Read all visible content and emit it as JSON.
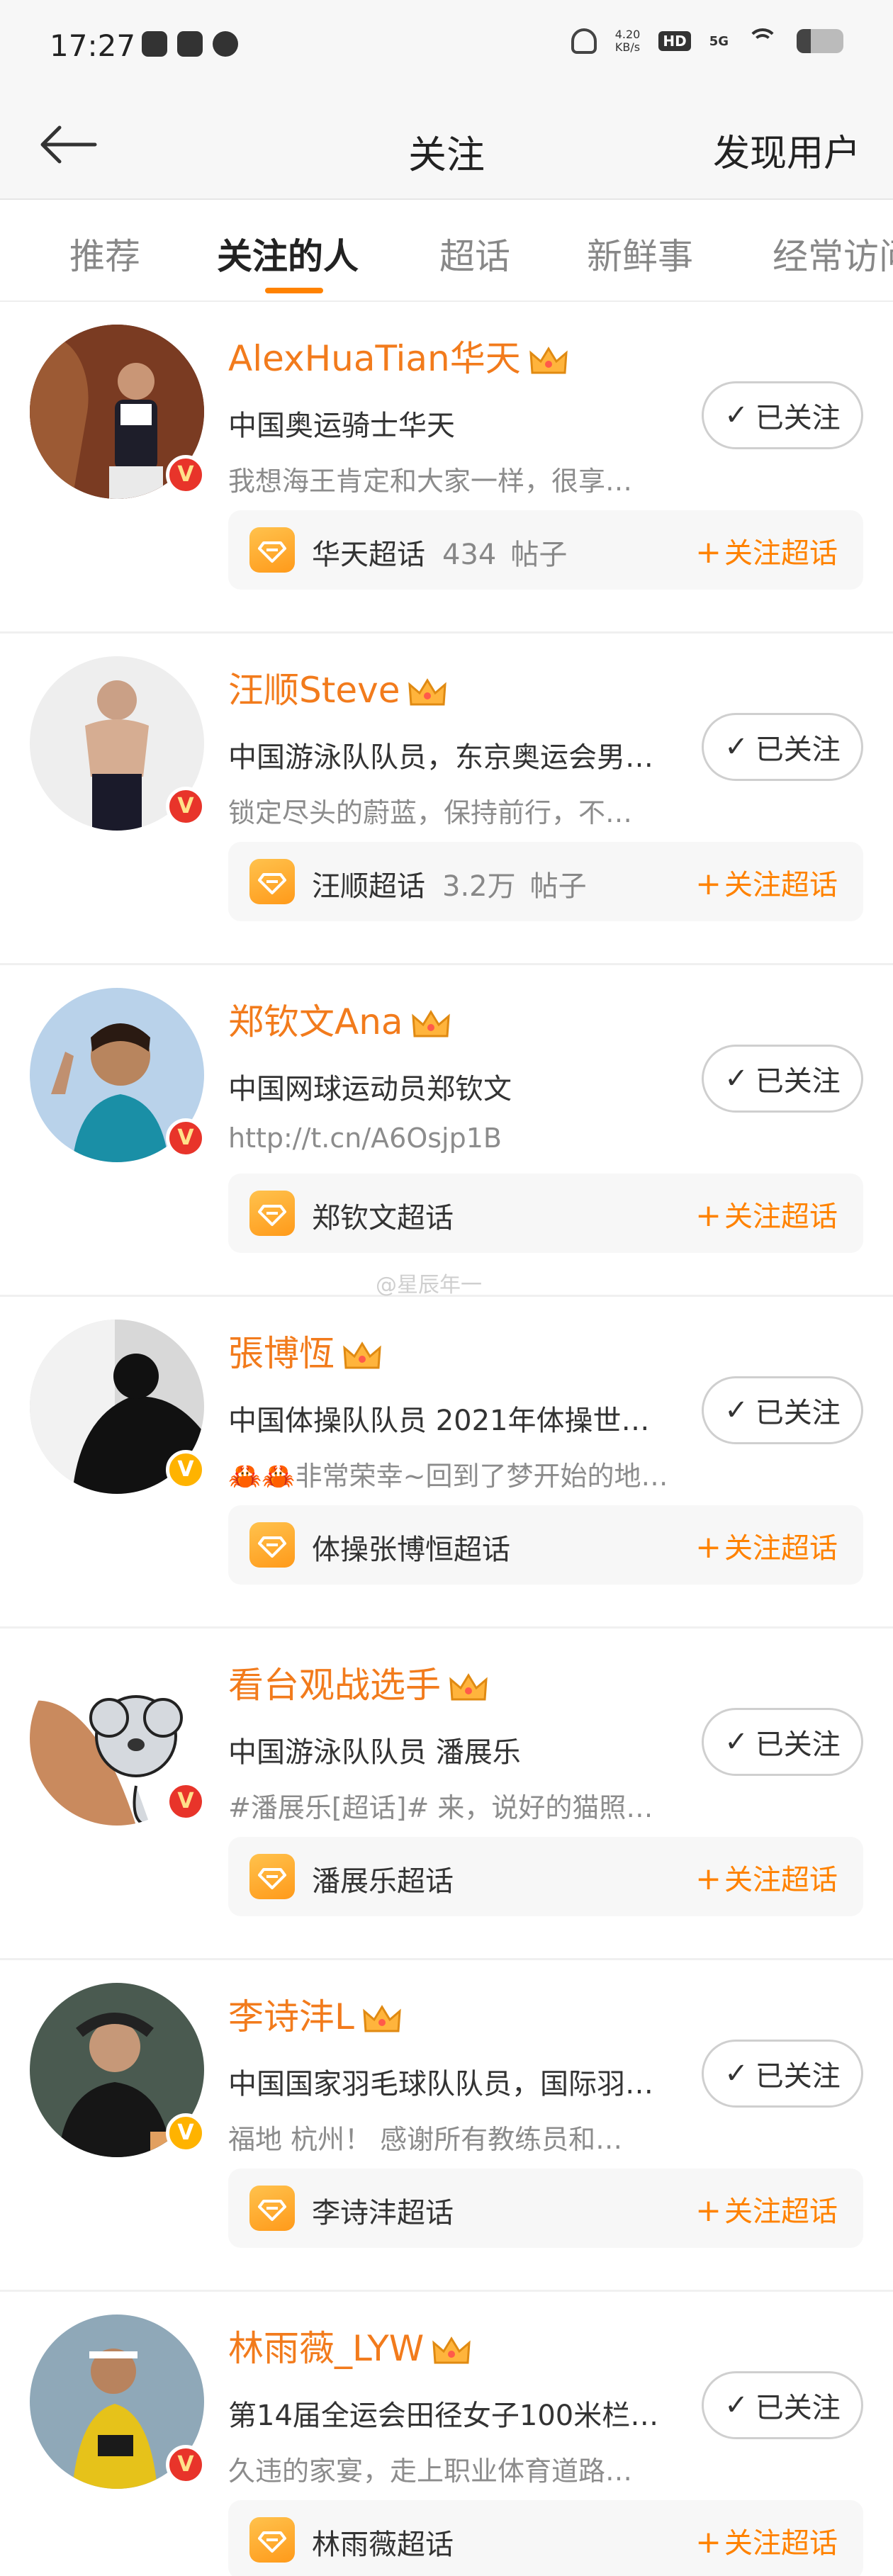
{
  "status_bar": {
    "time": "17:27",
    "speed_value": "4.20",
    "speed_unit": "KB/s",
    "hd_label": "HD",
    "network_label": "5G"
  },
  "header": {
    "title": "关注",
    "discover_label": "发现用户"
  },
  "tabs": [
    {
      "label": "推荐",
      "active": false
    },
    {
      "label": "关注的人",
      "active": true
    },
    {
      "label": "超话",
      "active": false
    },
    {
      "label": "新鲜事",
      "active": false
    },
    {
      "label": "经常访问",
      "active": false
    }
  ],
  "watermark": "@星辰年一",
  "users": [
    {
      "name": "AlexHuaTian华天",
      "desc": "中国奥运骑士华天",
      "post": "我想海王肯定和大家一样，很享…",
      "follow_label": "已关注",
      "supertopic": {
        "name": "华天超话",
        "count": "434",
        "unit": "帖子",
        "follow_label": "关注超话"
      }
    },
    {
      "name": "汪顺Steve",
      "desc": "中国游泳队队员，东京奥运会男…",
      "post": "锁定尽头的蔚蓝，保持前行，不…",
      "follow_label": "已关注",
      "supertopic": {
        "name": "汪顺超话",
        "count": "3.2万",
        "unit": "帖子",
        "follow_label": "关注超话"
      }
    },
    {
      "name": "郑钦文Ana",
      "desc": "中国网球运动员郑钦文",
      "post": "http://t.cn/A6Osjp1B",
      "follow_label": "已关注",
      "supertopic": {
        "name": "郑钦文超话",
        "count": "",
        "unit": "",
        "follow_label": "关注超话"
      }
    },
    {
      "name": "張博恆",
      "desc": "中国体操队队员 2021年体操世…",
      "post": "🦀🦀非常荣幸~回到了梦开始的地…",
      "follow_label": "已关注",
      "supertopic": {
        "name": "体操张博恒超话",
        "count": "",
        "unit": "",
        "follow_label": "关注超话"
      }
    },
    {
      "name": "看台观战选手",
      "desc": "中国游泳队队员 潘展乐",
      "post": "#潘展乐[超话]# 来，说好的猫照…",
      "follow_label": "已关注",
      "supertopic": {
        "name": "潘展乐超话",
        "count": "",
        "unit": "",
        "follow_label": "关注超话"
      }
    },
    {
      "name": "李诗沣L",
      "desc": "中国国家羽毛球队队员，国际羽…",
      "post": "福地 杭州！ 感谢所有教练员和…",
      "follow_label": "已关注",
      "supertopic": {
        "name": "李诗沣超话",
        "count": "",
        "unit": "",
        "follow_label": "关注超话"
      }
    },
    {
      "name": "林雨薇_LYW",
      "desc": "第14届全运会田径女子100米栏…",
      "post": "久违的家宴，走上职业体育道路…",
      "follow_label": "已关注",
      "supertopic": {
        "name": "林雨薇超话",
        "count": "",
        "unit": "",
        "follow_label": "关注超话"
      }
    }
  ]
}
